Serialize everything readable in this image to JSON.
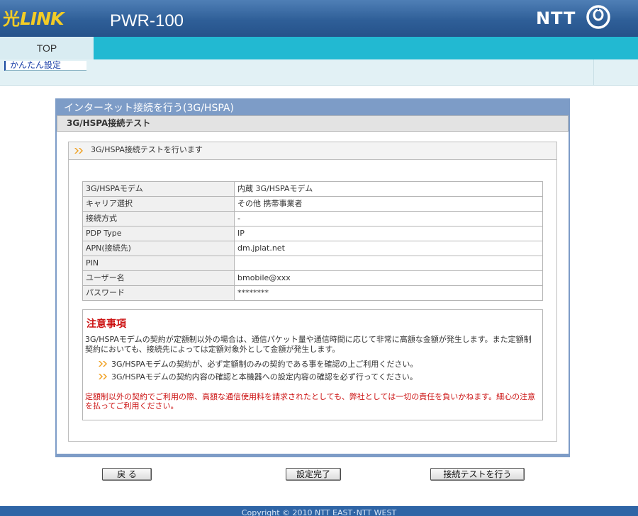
{
  "header": {
    "logo_text": "LINK",
    "logo_mark": "光",
    "model": "PWR-100",
    "brand": "NTT",
    "brand_icon": "ntt-logo-icon"
  },
  "nav": {
    "tab_top": "TOP",
    "subtab": "かんたん設定"
  },
  "panel": {
    "title": "インターネット接続を行う(3G/HSPA)",
    "section": "3G/HSPA接続テスト",
    "content_heading": "3G/HSPA接続テストを行います"
  },
  "settings": [
    {
      "key": "3G/HSPAモデム",
      "value": "内蔵 3G/HSPAモデム"
    },
    {
      "key": "キャリア選択",
      "value": "その他 携帯事業者"
    },
    {
      "key": "接続方式",
      "value": "-"
    },
    {
      "key": "PDP Type",
      "value": "IP"
    },
    {
      "key": "APN(接続先)",
      "value": "dm.jplat.net"
    },
    {
      "key": "PIN",
      "value": ""
    },
    {
      "key": "ユーザー名",
      "value": "bmobile@xxx"
    },
    {
      "key": "パスワード",
      "value": "********"
    }
  ],
  "caution": {
    "title": "注意事項",
    "body": "3G/HSPAモデムの契約が定額制以外の場合は、通信パケット量や通信時間に応じて非常に高額な金額が発生します。また定額制契約においても、接続先によっては定額対象外として金額が発生します。",
    "bullets": [
      "3G/HSPAモデムの契約が、必ず定額制のみの契約である事を確認の上ご利用ください。",
      "3G/HSPAモデムの契約内容の確認と本機器への設定内容の確認を必ず行ってください。"
    ],
    "warning": "定額制以外の契約でご利用の際、高額な通信使用料を請求されたとしても、弊社としては一切の責任を負いかねます。細心の注意を払ってご利用ください。"
  },
  "buttons": {
    "back": "戻 る",
    "finish": "設定完了",
    "test": "接続テストを行う"
  },
  "footer": {
    "copyright": "Copyright © 2010 NTT EAST･NTT WEST"
  },
  "colors": {
    "header": "#2f5f98",
    "tabbar": "#22b9d2",
    "panel": "#7d9cc7",
    "caution_red": "#cc1111",
    "logo_yellow": "#f2cc26"
  }
}
